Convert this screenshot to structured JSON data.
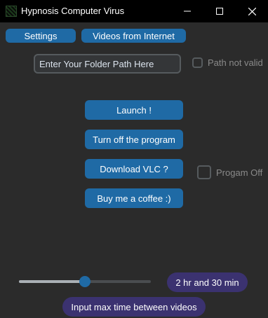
{
  "window": {
    "title": "Hypnosis Computer Virus",
    "app_icon": "hypnosis-app-icon",
    "controls": [
      "minimize-icon",
      "maximize-icon",
      "close-icon"
    ]
  },
  "top_buttons": {
    "settings": "Settings",
    "videos": "Videos from Internet"
  },
  "folder": {
    "placeholder": "Enter Your Folder Path Here",
    "status_label": "Path not valid",
    "status_checked": false
  },
  "actions": {
    "launch": "Launch !",
    "turn_off": "Turn off the program",
    "download_vlc": "Download VLC ?",
    "coffee": "Buy me a coffee :)"
  },
  "program_off": {
    "label": "Progam Off",
    "checked": false
  },
  "timer": {
    "slider_fraction": 0.5,
    "value_text": "2 hr and 30 min",
    "caption": "Input max time between videos"
  },
  "colors": {
    "accent": "#1f6aa5",
    "pill": "#3b3270",
    "background": "#2b2b2b",
    "titlebar": "#000000"
  }
}
